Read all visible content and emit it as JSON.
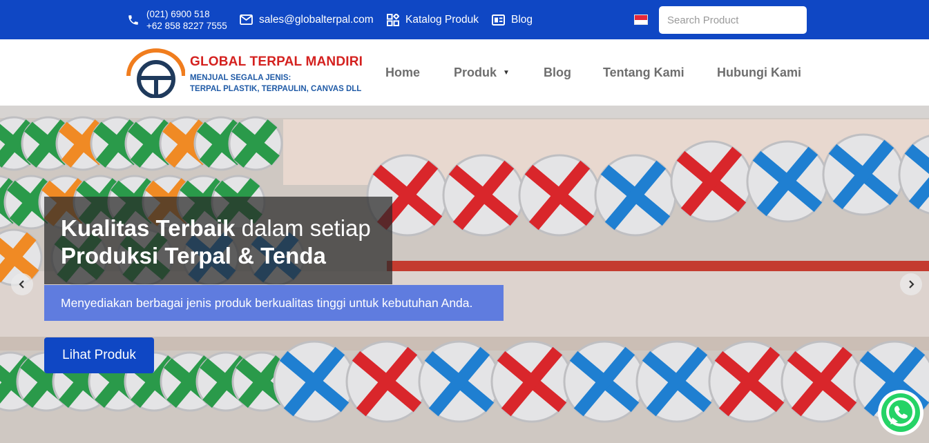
{
  "topbar": {
    "phone_1": "(021) 6900 518",
    "phone_2": "+62 858 8227 7555",
    "email": "sales@globalterpal.com",
    "katalog": "Katalog Produk",
    "blog": "Blog",
    "language_flag": "indonesia-flag",
    "search_placeholder": "Search Product",
    "background_color": "#0f47c4"
  },
  "header": {
    "brand_name": "GLOBAL TERPAL MANDIRI",
    "tagline_1": "MENJUAL SEGALA JENIS:",
    "tagline_2": "TERPAL PLASTIK, TERPAULIN, CANVAS DLL",
    "brand_color": "#d4211f",
    "tagline_color": "#1f5aa6"
  },
  "nav": {
    "home": "Home",
    "produk": "Produk",
    "blog": "Blog",
    "tentang": "Tentang Kami",
    "hubungi": "Hubungi Kami"
  },
  "hero": {
    "title_bold": "Kualitas Terbaik",
    "title_rest": " dalam setiap",
    "title_line2": "Produksi Terpal & Tenda",
    "subtitle": "Menyediakan berbagai jenis produk berkualitas tinggi untuk kebutuhan Anda.",
    "cta_label": "Lihat Produk",
    "prev_icon": "chevron-left-icon",
    "next_icon": "chevron-right-icon"
  },
  "floating": {
    "whatsapp_icon": "whatsapp-icon",
    "whatsapp_color": "#25d366"
  }
}
